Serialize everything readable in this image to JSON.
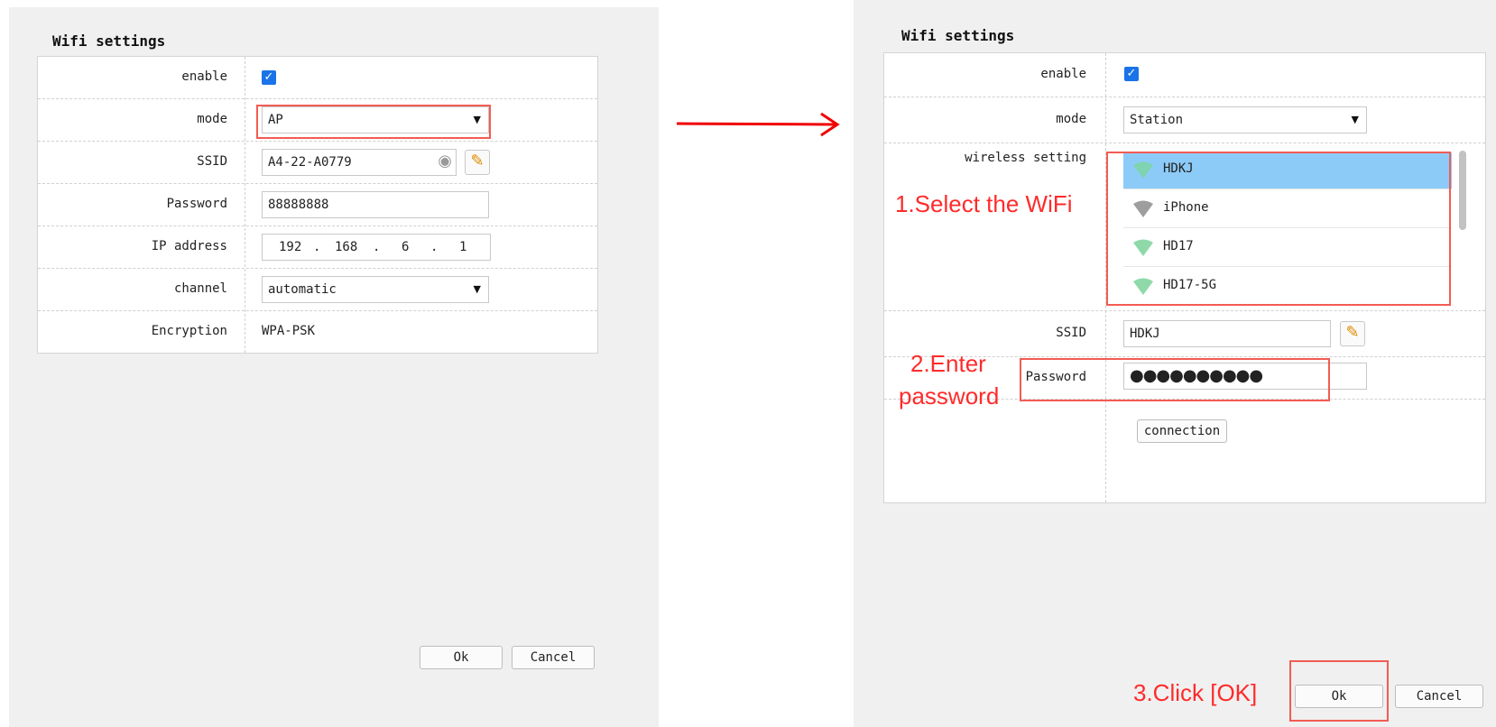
{
  "left": {
    "title": "Wifi settings",
    "rows": {
      "enable_label": "enable",
      "mode_label": "mode",
      "mode_value": "AP",
      "ssid_label": "SSID",
      "ssid_value": "A4-22-A0779",
      "password_label": "Password",
      "password_value": "88888888",
      "ip_label": "IP address",
      "ip": [
        "192",
        "168",
        "6",
        "1"
      ],
      "channel_label": "channel",
      "channel_value": "automatic",
      "encryption_label": "Encryption",
      "encryption_value": "WPA-PSK"
    },
    "ok_label": "Ok",
    "cancel_label": "Cancel"
  },
  "arrow_color": "#f00000",
  "right": {
    "title": "Wifi settings",
    "rows": {
      "enable_label": "enable",
      "mode_label": "mode",
      "mode_value": "Station",
      "wireless_label": "wireless setting",
      "networks": [
        {
          "name": "HDKJ",
          "selected": true,
          "icon": "wifi-icon",
          "color": "#7fd3b0"
        },
        {
          "name": "iPhone",
          "selected": false,
          "icon": "wifi-icon",
          "color": "#9e9e9e"
        },
        {
          "name": "HD17",
          "selected": false,
          "icon": "wifi-icon",
          "color": "#8fd9a8"
        },
        {
          "name": "HD17-5G",
          "selected": false,
          "icon": "wifi-icon",
          "color": "#8fd9a8"
        }
      ],
      "ssid_label": "SSID",
      "ssid_value": "HDKJ",
      "password_label": "Password",
      "password_value": "●●●●●●●●●●",
      "connection_label": "connection"
    },
    "ok_label": "Ok",
    "cancel_label": "Cancel"
  },
  "annotations": {
    "step1": "1.Select the WiFi",
    "step2_line1": "2.Enter",
    "step2_line2": "password",
    "step3": "3.Click [OK]"
  },
  "colors": {
    "accent": "#1a73e8",
    "annotation": "#ff2b2b",
    "selected_row": "#8ccbf8"
  }
}
